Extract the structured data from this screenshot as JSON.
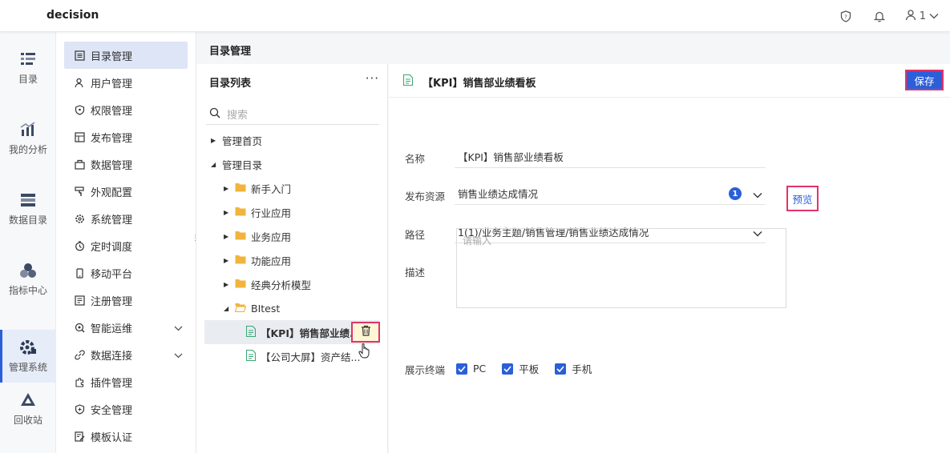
{
  "app": {
    "brand": "decision",
    "user_name": "1"
  },
  "rail": [
    {
      "label": "目录",
      "icon": "catalog-icon"
    },
    {
      "label": "我的分析",
      "icon": "analysis-icon"
    },
    {
      "label": "数据目录",
      "icon": "data-catalog-icon"
    },
    {
      "label": "指标中心",
      "icon": "metrics-center-icon"
    },
    {
      "label": "管理系统",
      "icon": "manage-system-icon",
      "active": true
    },
    {
      "label": "回收站",
      "icon": "recycle-icon"
    }
  ],
  "subnav": [
    {
      "label": "目录管理",
      "icon": "list-icon",
      "active": true
    },
    {
      "label": "用户管理",
      "icon": "user-icon"
    },
    {
      "label": "权限管理",
      "icon": "shield-icon"
    },
    {
      "label": "发布管理",
      "icon": "publish-icon"
    },
    {
      "label": "数据管理",
      "icon": "data-icon"
    },
    {
      "label": "外观配置",
      "icon": "paint-icon"
    },
    {
      "label": "系统管理",
      "icon": "gear-icon"
    },
    {
      "label": "定时调度",
      "icon": "timer-icon"
    },
    {
      "label": "移动平台",
      "icon": "mobile-icon"
    },
    {
      "label": "注册管理",
      "icon": "register-icon"
    },
    {
      "label": "智能运维",
      "icon": "ops-icon",
      "expandable": true
    },
    {
      "label": "数据连接",
      "icon": "link-icon",
      "expandable": true
    },
    {
      "label": "插件管理",
      "icon": "plugin-icon"
    },
    {
      "label": "安全管理",
      "icon": "security-icon"
    },
    {
      "label": "模板认证",
      "icon": "template-icon"
    }
  ],
  "main": {
    "title": "目录管理"
  },
  "tree": {
    "title": "目录列表",
    "more": "···",
    "search_placeholder": "搜索",
    "nodes": [
      {
        "label": "管理首页",
        "level": 0,
        "kind": "collapsed"
      },
      {
        "label": "管理目录",
        "level": 0,
        "kind": "expanded"
      },
      {
        "label": "新手入门",
        "level": 1,
        "kind": "folder"
      },
      {
        "label": "行业应用",
        "level": 1,
        "kind": "folder"
      },
      {
        "label": "业务应用",
        "level": 1,
        "kind": "folder"
      },
      {
        "label": "功能应用",
        "level": 1,
        "kind": "folder"
      },
      {
        "label": "经典分析模型",
        "level": 1,
        "kind": "folder"
      },
      {
        "label": "BItest",
        "level": 1,
        "kind": "open-folder"
      },
      {
        "label": "【KPI】销售部业绩...",
        "level": 2,
        "kind": "report",
        "selected": true
      },
      {
        "label": "【公司大屏】资产结...",
        "level": 2,
        "kind": "report"
      }
    ]
  },
  "form": {
    "title": "【KPI】销售部业绩看板",
    "save_label": "保存",
    "name_label": "名称",
    "name_value": "【KPI】销售部业绩看板",
    "publish_label": "发布资源",
    "publish_value": "销售业绩达成情况",
    "publish_count": "1",
    "path_label": "路径",
    "path_value": "1(1)/业务主题/销售管理/销售业绩达成情况",
    "preview_label": "预览",
    "desc_label": "描述",
    "desc_placeholder": "请输入",
    "terminal_label": "展示终端",
    "terminals": [
      "PC",
      "平板",
      "手机"
    ]
  },
  "colors": {
    "accent": "#2b5fd9",
    "highlight_border": "#e0336a",
    "folder": "#f2b43d",
    "report": "#3aa876"
  }
}
